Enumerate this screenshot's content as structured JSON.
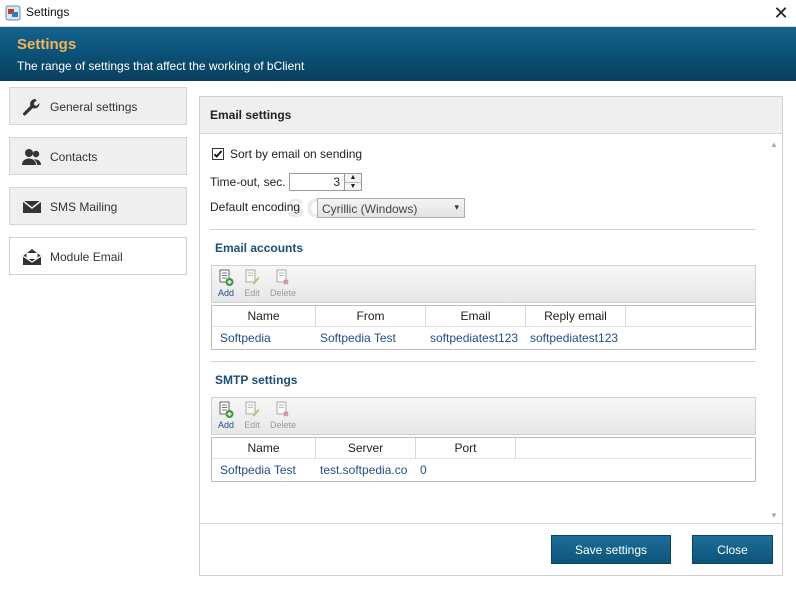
{
  "window": {
    "title": "Settings",
    "close_glyph": "✕"
  },
  "header": {
    "title": "Settings",
    "subtitle": "The range of settings that affect the working of bClient",
    "title_color": "#f2b559"
  },
  "sidebar": {
    "items": [
      {
        "label": "General settings",
        "icon": "wrench-icon",
        "active": false
      },
      {
        "label": "Contacts",
        "icon": "people-icon",
        "active": false
      },
      {
        "label": "SMS Mailing",
        "icon": "envelope-icon",
        "active": false
      },
      {
        "label": "Module Email",
        "icon": "open-envelope-icon",
        "active": true
      }
    ]
  },
  "email_settings": {
    "title": "Email settings",
    "sort_by_email": {
      "label": "Sort by email on sending",
      "checked": true
    },
    "timeout": {
      "label": "Time-out, sec.",
      "value": "3"
    },
    "encoding": {
      "label": "Default encoding",
      "value": "Cyrillic (Windows)"
    },
    "accounts": {
      "title": "Email accounts",
      "toolbar": {
        "add": "Add",
        "edit": "Edit",
        "delete": "Delete"
      },
      "columns": [
        "Name",
        "From",
        "Email",
        "Reply email"
      ],
      "rows": [
        [
          "Softpedia",
          "Softpedia Test",
          "softpediatest123",
          "softpediatest123"
        ]
      ]
    },
    "smtp": {
      "title": "SMTP settings",
      "toolbar": {
        "add": "Add",
        "edit": "Edit",
        "delete": "Delete"
      },
      "columns": [
        "Name",
        "Server",
        "Port"
      ],
      "rows": [
        [
          "Softpedia Test",
          "test.softpedia.com",
          "0"
        ]
      ]
    }
  },
  "footer": {
    "save_label": "Save settings",
    "close_label": "Close"
  },
  "watermark": "SOFTPEDIA",
  "colors": {
    "accent": "#0f5479",
    "section_title": "#1d4e74",
    "link_text": "#1f4e85"
  }
}
